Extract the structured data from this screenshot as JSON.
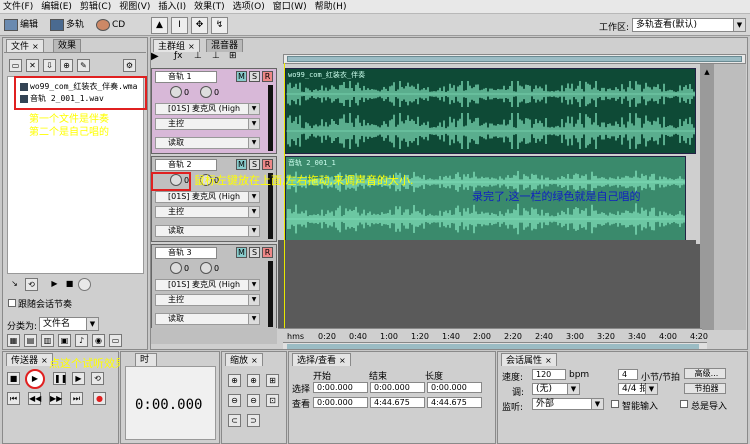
{
  "menu": [
    "文件(F)",
    "编辑(E)",
    "剪辑(C)",
    "视图(V)",
    "插入(I)",
    "效果(T)",
    "选项(O)",
    "窗口(W)",
    "帮助(H)"
  ],
  "toolbar": {
    "edit": "编辑",
    "multitrack": "多轨",
    "cd": "CD",
    "workspace_label": "工作区:",
    "workspace_value": "多轨查看(默认)"
  },
  "files_panel": {
    "tab_files": "文件",
    "tab_effects": "效果",
    "files": [
      "wo99_com_红装衣_伴奏.wma",
      "音轨 2_001_1.wav"
    ],
    "annotation": [
      "第一个文件是伴奏",
      "第二个是自己唱的"
    ],
    "follow_session": "跟随会话节奏",
    "sort_label": "分类为:",
    "sort_value": "文件名"
  },
  "main_panel": {
    "tab_main": "主群组",
    "tab_mixer": "混音器"
  },
  "tracks": [
    {
      "name": "音轨 1",
      "vol": "0",
      "pan": "0",
      "input": "[01S] 麦克风 (High",
      "output": "主控",
      "mode": "读取",
      "clip": "wo99_com_红装衣_伴奏"
    },
    {
      "name": "音轨 2",
      "vol": "0",
      "pan": "0",
      "input": "[01S] 麦克风 (High",
      "output": "主控",
      "mode": "读取",
      "clip": "音轨 2_001_1"
    },
    {
      "name": "音轨 3",
      "vol": "0",
      "pan": "0",
      "input": "[01S] 麦克风 (High",
      "output": "主控",
      "mode": "读取",
      "clip": ""
    }
  ],
  "msr": [
    "M",
    "S",
    "R"
  ],
  "annotations": {
    "volume": "鼠标左键放在上面,左右拖动,来调声音的大小.",
    "green": "录完了,这一栏的绿色就是自己唱的",
    "play": "点这个试听效果"
  },
  "ruler": [
    "hms",
    "0:20",
    "0:40",
    "1:00",
    "1:20",
    "1:40",
    "2:00",
    "2:20",
    "2:40",
    "3:00",
    "3:20",
    "3:40",
    "4:00",
    "4:20"
  ],
  "transport": {
    "tab": "传送器",
    "tab2": "时间",
    "time": "0:00.000"
  },
  "zoom": {
    "tab": "缩放"
  },
  "selection": {
    "tab": "选择/查看",
    "col_start": "开始",
    "col_end": "结束",
    "col_length": "长度",
    "row_sel": "选择",
    "row_view": "查看",
    "sel_start": "0:00.000",
    "sel_end": "0:00.000",
    "sel_len": "0:00.000",
    "view_start": "0:00.000",
    "view_end": "4:44.675",
    "view_len": "4:44.675"
  },
  "session": {
    "tab": "会话属性",
    "speed_label": "速度:",
    "speed_value": "120",
    "bpm": "bpm",
    "beats": "4",
    "beats_unit": "小节/节拍",
    "advanced": "高级...",
    "key_label": "调:",
    "key_value": "(无)",
    "time_sig": "4/4 拍",
    "metronome": "节拍器",
    "monitor_label": "监听:",
    "monitor_value": "外部",
    "smart_input": "智能输入",
    "always_import": "总是导入"
  },
  "colors": {
    "clip_dark": "#0e4a36",
    "clip_light": "#3a8a6c",
    "wave": "#8ef0c8",
    "anno_yellow": "#ffff00",
    "anno_blue": "#1020c0",
    "red": "#e02020"
  }
}
